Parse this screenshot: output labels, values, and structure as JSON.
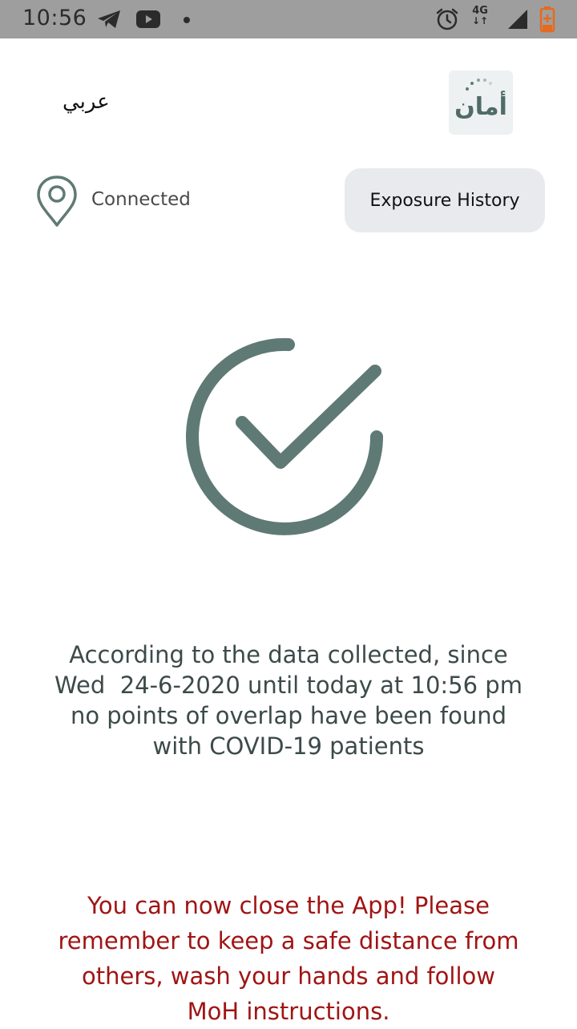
{
  "status_bar": {
    "time": "10:56",
    "network": "4G",
    "icons": [
      "telegram-icon",
      "youtube-icon",
      "notification-dot-icon",
      "alarm-icon",
      "network-4g-icon",
      "signal-icon",
      "battery-icon"
    ]
  },
  "header": {
    "language_link": "عربي",
    "logo_text": "أمان"
  },
  "status": {
    "connected_label": "Connected",
    "exposure_button": "Exposure History"
  },
  "result": {
    "line1": "According to the data collected, since",
    "line2": "Wed  24-6-2020 until today at 10:56 pm",
    "line3": "no points of overlap have been found",
    "line4": "with COVID-19 patients"
  },
  "advice": {
    "line1": "You can now close the App! Please",
    "line2": "remember to keep a safe distance from",
    "line3": "others, wash your hands and follow",
    "line4": "MoH instructions."
  },
  "colors": {
    "accent": "#5f7a74",
    "warning": "#a01414",
    "status_bar": "#9e9e9e",
    "button_bg": "#e8eaee"
  }
}
